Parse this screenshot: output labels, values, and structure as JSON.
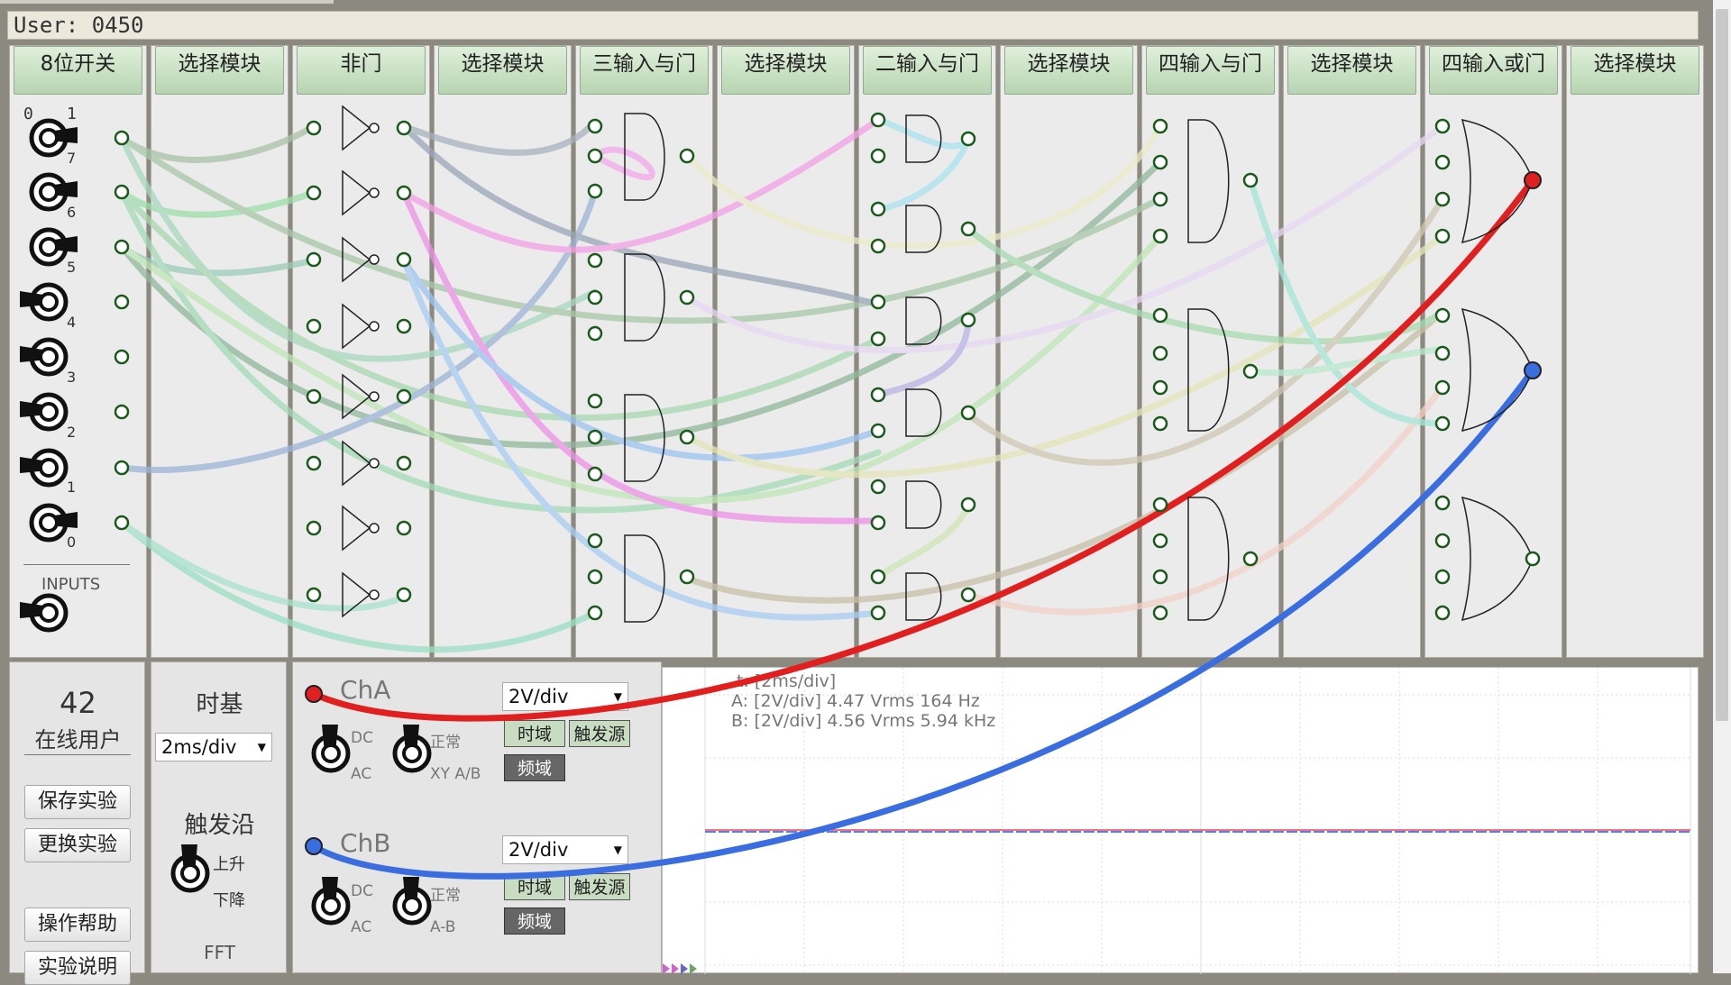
{
  "user_bar": {
    "label": "User: 0450"
  },
  "columns": [
    {
      "title": "8位开关"
    },
    {
      "title": "选择模块"
    },
    {
      "title": "非门"
    },
    {
      "title": "选择模块"
    },
    {
      "title": "三输入与门"
    },
    {
      "title": "选择模块"
    },
    {
      "title": "二输入与门"
    },
    {
      "title": "选择模块"
    },
    {
      "title": "四输入与门"
    },
    {
      "title": "选择模块"
    },
    {
      "title": "四输入或门"
    },
    {
      "title": "选择模块"
    }
  ],
  "switches": {
    "top_labels": [
      "0",
      "1"
    ],
    "numbers": [
      "7",
      "6",
      "5",
      "4",
      "3",
      "2",
      "1",
      "0"
    ],
    "inputs_label": "INPUTS"
  },
  "online": {
    "count": "42",
    "label": "在线用户"
  },
  "buttons": {
    "save": "保存实验",
    "change": "更换实验",
    "help": "操作帮助",
    "desc": "实验说明"
  },
  "timebase": {
    "title": "时基",
    "value": "2ms/div",
    "trigger_title": "触发沿",
    "rise": "上升",
    "fall": "下降",
    "fft": "FFT"
  },
  "channel_a": {
    "name": "ChA",
    "volts": "2V/div",
    "dc": "DC",
    "ac": "AC",
    "normal": "正常",
    "mode2": "XY A/B",
    "time_btn": "时域",
    "trig_btn": "触发源",
    "freq_btn": "频域",
    "color": "#e02020"
  },
  "channel_b": {
    "name": "ChB",
    "volts": "2V/div",
    "dc": "DC",
    "ac": "AC",
    "normal": "正常",
    "mode2": "A-B",
    "time_btn": "时域",
    "trig_btn": "触发源",
    "freq_btn": "频域",
    "color": "#3a6ee0"
  },
  "scope": {
    "line_t": "t: [2ms/div]",
    "line_a": "A: [2V/div] 4.47 Vrms   164 Hz",
    "line_b": "B: [2V/div] 4.56 Vrms   5.94 kHz"
  }
}
